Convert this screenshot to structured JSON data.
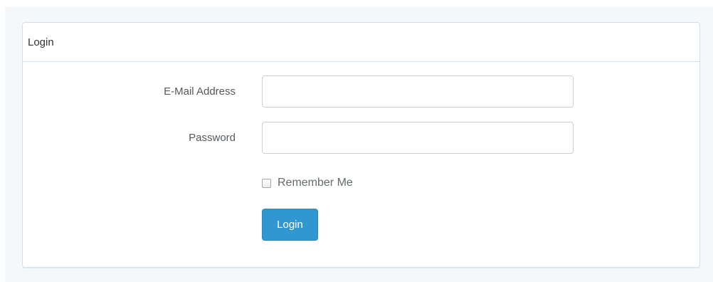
{
  "panel": {
    "heading": "Login"
  },
  "form": {
    "email_label": "E-Mail Address",
    "email_value": "",
    "password_label": "Password",
    "password_value": "",
    "remember_label": "Remember Me",
    "remember_checked": false,
    "submit_label": "Login"
  },
  "colors": {
    "page_background": "#f5f8fa",
    "panel_border": "#d3e0e9",
    "primary_button": "#3097d1",
    "text": "#636b6f"
  }
}
